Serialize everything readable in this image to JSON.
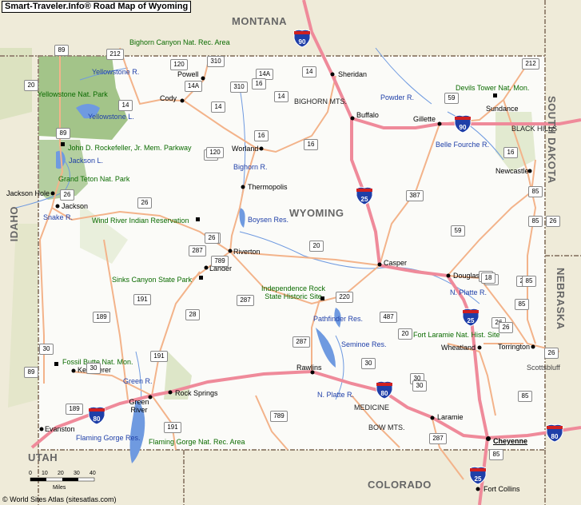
{
  "title": "Smart-Traveler.Info® Road Map of Wyoming",
  "credit": "© World Sites Atlas (sitesatlas.com)",
  "scale": {
    "ticks": [
      "0",
      "10",
      "20",
      "30",
      "40"
    ],
    "unit": "Miles"
  },
  "states": {
    "montana": "MONTANA",
    "south_dakota": "SOUTH DAKOTA",
    "nebraska": "NEBRASKA",
    "idaho": "IDAHO",
    "utah": "UTAH",
    "colorado": "COLORADO",
    "wyoming": "WYOMING"
  },
  "cities": {
    "sheridan": "Sheridan",
    "powell": "Powell",
    "cody": "Cody",
    "buffalo": "Buffalo",
    "gillette": "Gillette",
    "sundance": "Sundance",
    "newcastle": "Newcastle",
    "worland": "Worland",
    "thermopolis": "Thermopolis",
    "jackson_hole": "Jackson Hole",
    "jackson": "Jackson",
    "riverton": "Riverton",
    "lander": "Lander",
    "casper": "Casper",
    "douglas": "Douglas",
    "wheatland": "Wheatland",
    "torrington": "Torrington",
    "scottsbluff": "Scottsbluff",
    "rawlins": "Rawlins",
    "kemmerer": "Kemmerer",
    "rock_springs": "Rock Springs",
    "green_river": "Green River",
    "evanston": "Evanston",
    "laramie": "Laramie",
    "cheyenne": "Cheyenne",
    "fort_collins": "Fort Collins"
  },
  "parks": {
    "bighorn_canyon": "Bighorn Canyon Nat. Rec. Area",
    "yellowstone_np": "Yellowstone Nat. Park",
    "devils_tower": "Devils Tower Nat. Mon.",
    "rockefeller": "John D. Rockefeller, Jr. Mem. Parkway",
    "grand_teton": "Grand Teton Nat. Park",
    "wind_river": "Wind River Indian Reservation",
    "sinks_canyon": "Sinks Canyon State Park",
    "independence_rock": "Independence Rock State Historic Site",
    "fort_laramie": "Fort Laramie Nat. Hist. Site",
    "fossil_butte": "Fossil Butte Nat. Mon.",
    "flaming_gorge_rec": "Flaming Gorge Nat. Rec. Area"
  },
  "water": {
    "yellowstone_r": "Yellowstone R.",
    "yellowstone_l": "Yellowstone L.",
    "jackson_l": "Jackson L.",
    "snake_r": "Snake R.",
    "powder_r": "Powder R.",
    "belle_fourche": "Belle Fourche R.",
    "bighorn_r": "Bighorn R.",
    "boysen": "Boysen Res.",
    "n_platte_1": "N. Platte R.",
    "pathfinder": "Pathfinder Res.",
    "seminoe": "Seminoe Res.",
    "green_r": "Green R.",
    "n_platte_2": "N. Platte R.",
    "flaming_gorge_res": "Flaming Gorge Res."
  },
  "mountains": {
    "bighorn": "BIGHORN MTS.",
    "black_hills": "BLACK HILLS",
    "medicine_bow_1": "MEDICINE",
    "medicine_bow_2": "BOW MTS."
  },
  "interstates": [
    "90",
    "90",
    "25",
    "25",
    "80",
    "80",
    "80",
    "25"
  ],
  "routes": [
    "212",
    "89",
    "20",
    "120",
    "310",
    "14A",
    "310",
    "14A",
    "14",
    "14",
    "14",
    "14",
    "16",
    "16",
    "16",
    "16",
    "20",
    "120",
    "89",
    "26",
    "26",
    "26",
    "20",
    "387",
    "212",
    "59",
    "59",
    "16",
    "85",
    "85",
    "18",
    "20",
    "789",
    "287",
    "26",
    "191",
    "189",
    "189",
    "30",
    "89",
    "30",
    "191",
    "28",
    "287",
    "220",
    "487",
    "20",
    "18",
    "85",
    "26",
    "287",
    "30",
    "30",
    "191",
    "789",
    "85",
    "287",
    "85",
    "30",
    "26",
    "85",
    "26",
    "26"
  ],
  "colors": {
    "background": "#efebd9",
    "state_fill": "#fbfbf8",
    "park_green": "#a3c489",
    "interstate_road": "#ef8a9a",
    "state_road": "#f3b38a",
    "water": "#6f9ae0",
    "border": "#9a8a78"
  }
}
